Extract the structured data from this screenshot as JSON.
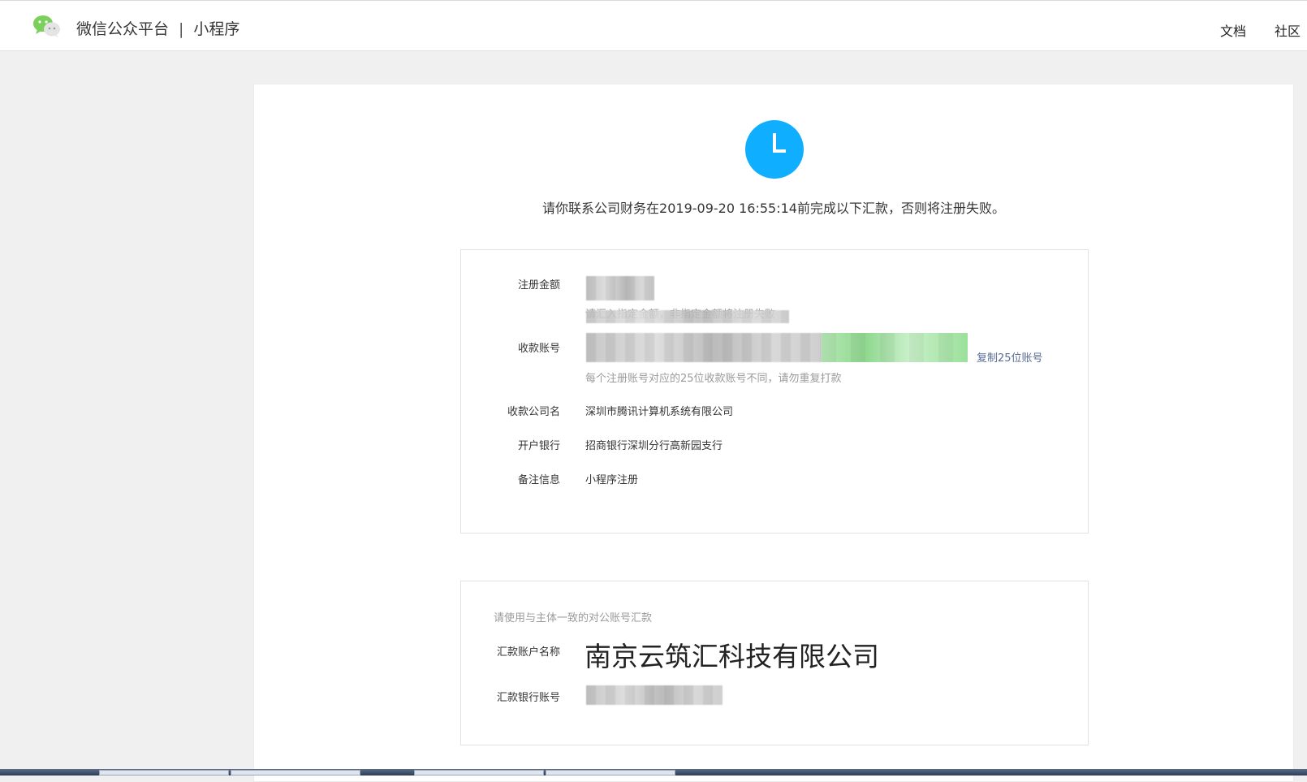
{
  "header": {
    "brand": "微信公众平台",
    "separator": "|",
    "product": "小程序",
    "nav": {
      "docs": "文档",
      "community": "社区"
    }
  },
  "notice": "请你联系公司财务在2019-09-20 16:55:14前完成以下汇款，否则将注册失败。",
  "payment_info": {
    "amount_label": "注册金额",
    "amount_tip": "请汇入指定金额，非指定金额将注册失败",
    "account_label": "收款账号",
    "copy_link": "复制25位账号",
    "account_tip": "每个注册账号对应的25位收款账号不同，请勿重复打款",
    "company_label": "收款公司名",
    "company_value": "深圳市腾讯计算机系统有限公司",
    "bank_label": "开户银行",
    "bank_value": "招商银行深圳分行高新园支行",
    "memo_label": "备注信息",
    "memo_value": "小程序注册"
  },
  "sender_info": {
    "hint": "请使用与主体一致的对公账号汇款",
    "name_label": "汇款账户名称",
    "name_value": "南京云筑汇科技有限公司",
    "account_label": "汇款银行账号"
  },
  "colors": {
    "accent": "#10aeff",
    "link": "#576b95"
  },
  "icons": {
    "logo": "wechat-logo-icon",
    "status": "clock-icon"
  }
}
